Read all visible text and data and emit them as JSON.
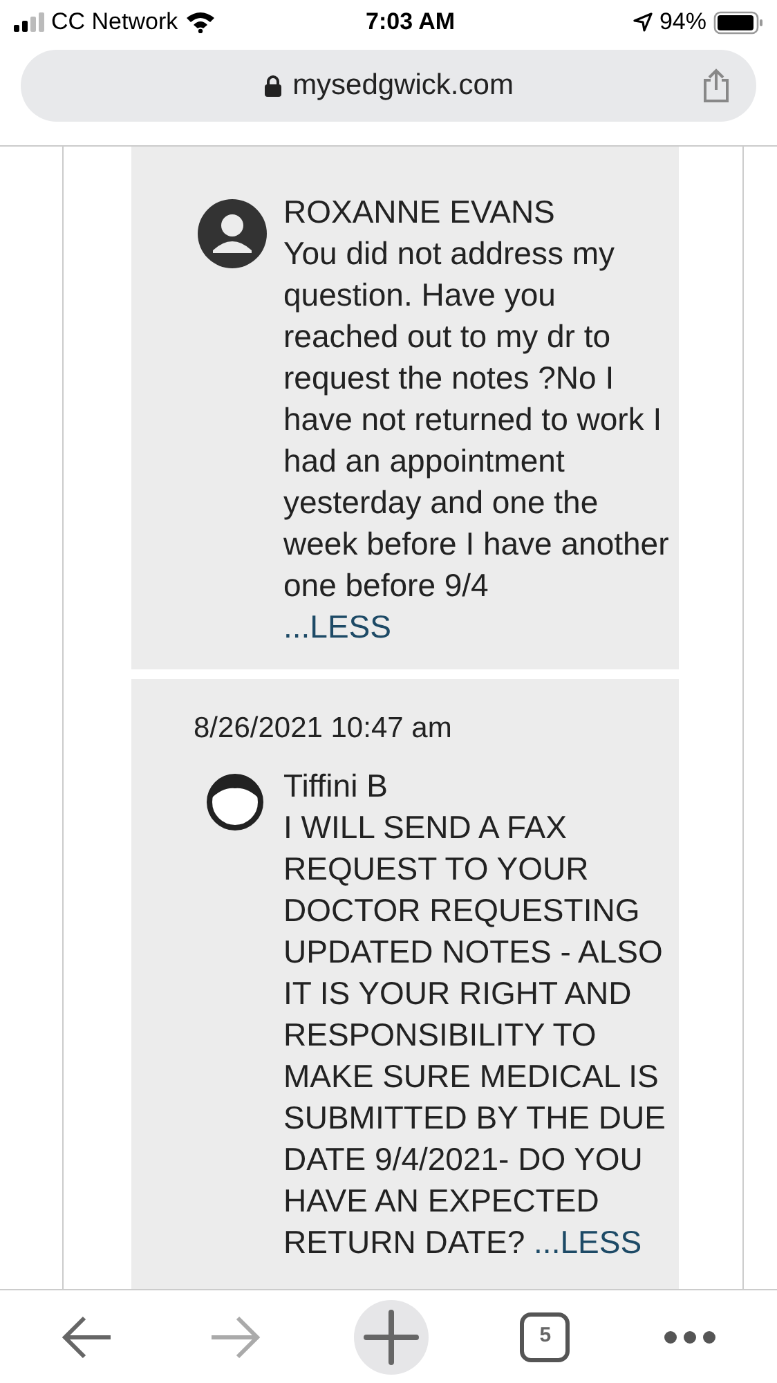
{
  "status_bar": {
    "carrier": "CC Network",
    "time": "7:03 AM",
    "battery": "94%"
  },
  "address_bar": {
    "url": "mysedgwick.com"
  },
  "messages": [
    {
      "author": "ROXANNE EVANS",
      "kind": "person",
      "text": "You did not address my question. Have you reached out to my dr to request the notes ?No I have not returned to work I had an appointment yesterday and one the week before I have another one before 9/4",
      "toggle": "...LESS",
      "toggle_inline": false
    },
    {
      "date": "8/26/2021 10:47 am",
      "author": "Tiffini B",
      "kind": "face",
      "text": "I WILL SEND A FAX REQUEST TO YOUR DOCTOR REQUESTING UPDATED NOTES - ALSO IT IS YOUR RIGHT AND RESPONSIBILITY TO MAKE SURE MEDICAL IS SUBMITTED BY THE DUE DATE 9/4/2021- DO YOU HAVE AN EXPECTED RETURN DATE?",
      "toggle": "...LESS",
      "toggle_inline": true
    }
  ],
  "toolbar": {
    "tab_count": "5"
  }
}
